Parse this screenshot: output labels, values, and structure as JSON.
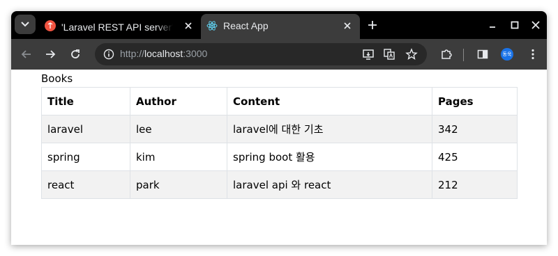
{
  "browser": {
    "tabs": [
      {
        "title": "'Laravel REST API server' 카",
        "active": false
      },
      {
        "title": "React App",
        "active": true
      }
    ],
    "url_scheme": "http://",
    "url_host": "localhost",
    "url_port": ":3000",
    "avatar_text": "동욱",
    "accent": "#1a73e8"
  },
  "page": {
    "heading": "Books",
    "columns": [
      "Title",
      "Author",
      "Content",
      "Pages"
    ],
    "rows": [
      {
        "title": "laravel",
        "author": "lee",
        "content": "laravel에 대한 기초",
        "pages": "342"
      },
      {
        "title": "spring",
        "author": "kim",
        "content": "spring boot 활용",
        "pages": "425"
      },
      {
        "title": "react",
        "author": "park",
        "content": "laravel api 와 react",
        "pages": "212"
      }
    ]
  }
}
